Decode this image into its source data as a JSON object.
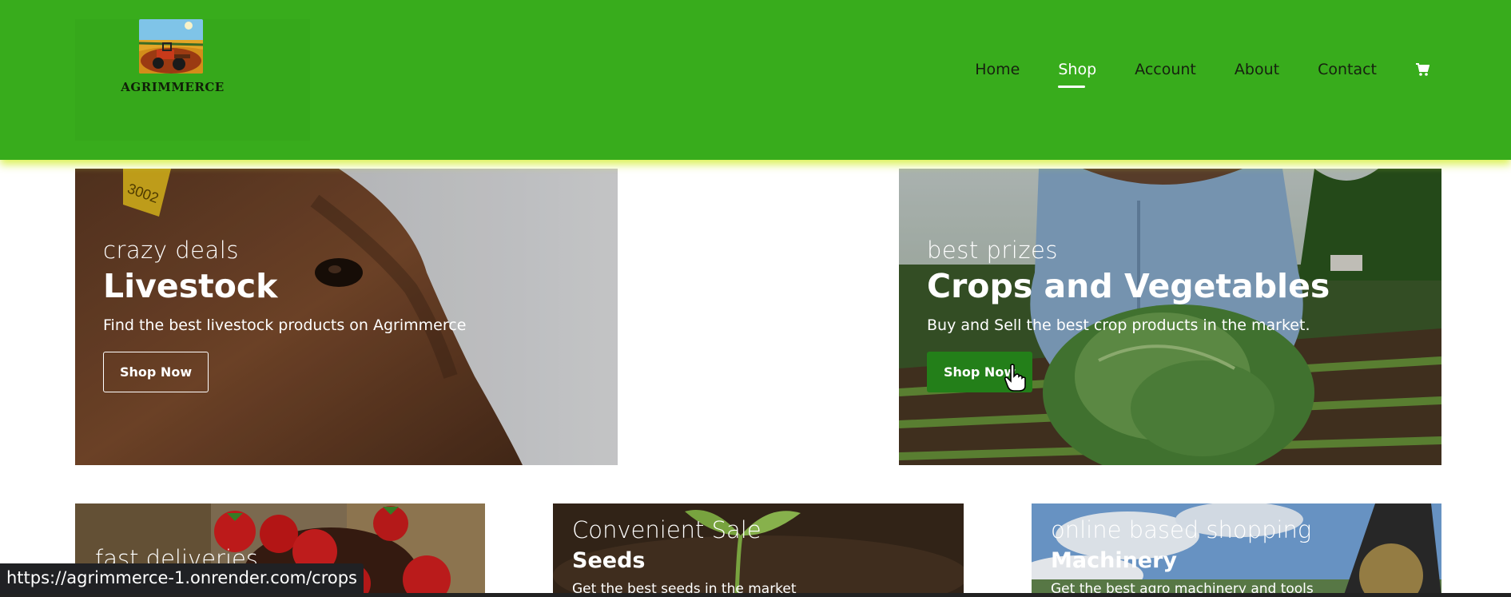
{
  "brand": {
    "name": "AGRIMMERCE"
  },
  "nav": {
    "items": [
      {
        "label": "Home",
        "active": false
      },
      {
        "label": "Shop",
        "active": true
      },
      {
        "label": "Account",
        "active": false
      },
      {
        "label": "About",
        "active": false
      },
      {
        "label": "Contact",
        "active": false
      }
    ],
    "cart_icon": "shopping-cart-icon"
  },
  "banners": [
    {
      "subtitle": "crazy deals",
      "title": "Livestock",
      "description": "Find the best livestock products on Agrimmerce",
      "button": "Shop Now"
    },
    {
      "subtitle": "best prizes",
      "title": "Crops and Vegetables",
      "description": "Buy and Sell the best crop products in the market.",
      "button": "Shop Now"
    }
  ],
  "small_banners": [
    {
      "subtitle": "fast deliveries",
      "title": "",
      "description": ""
    },
    {
      "subtitle": "Convenient Sale",
      "title": "Seeds",
      "description": "Get the best seeds in the market"
    },
    {
      "subtitle": "online based shopping",
      "title": "Machinery",
      "description": "Get the best agro machinery and tools"
    }
  ],
  "status_url": "https://agrimmerce-1.onrender.com/crops",
  "colors": {
    "header_bg": "#38ac1c",
    "header_glow": "#d6f03c",
    "button_green": "#237f19"
  }
}
